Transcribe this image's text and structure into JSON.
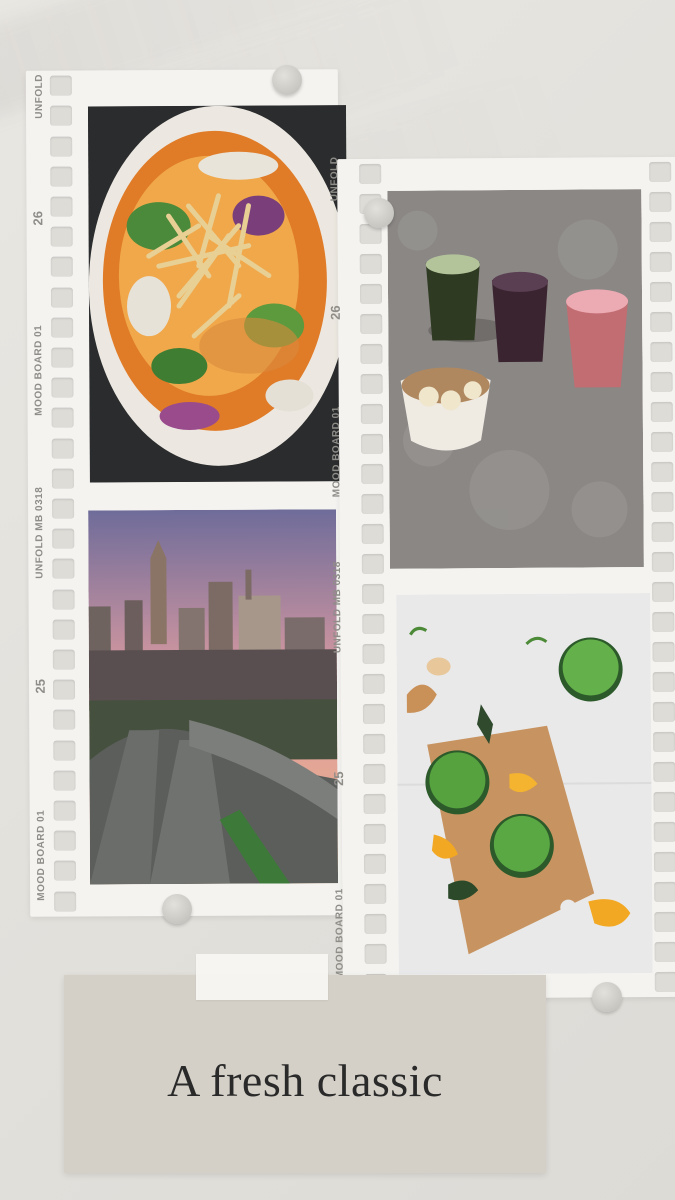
{
  "film_labels": {
    "unfold": "UNFOLD",
    "mood_board": "MOOD BOARD 01",
    "unfold_mb": "UNFOLD MB 0318",
    "num_26": "26",
    "num_25": "25"
  },
  "caption": "A fresh classic",
  "photos": [
    {
      "name": "salad-bowl",
      "subject": "Asian salad bowl with crispy noodles"
    },
    {
      "name": "city-skyline",
      "subject": "City skyline at sunset over highway"
    },
    {
      "name": "juices-on-sand",
      "subject": "Three juices and smoothie bowl on sand"
    },
    {
      "name": "green-juices",
      "subject": "Green juices on wooden board with ginger and lemon"
    }
  ]
}
